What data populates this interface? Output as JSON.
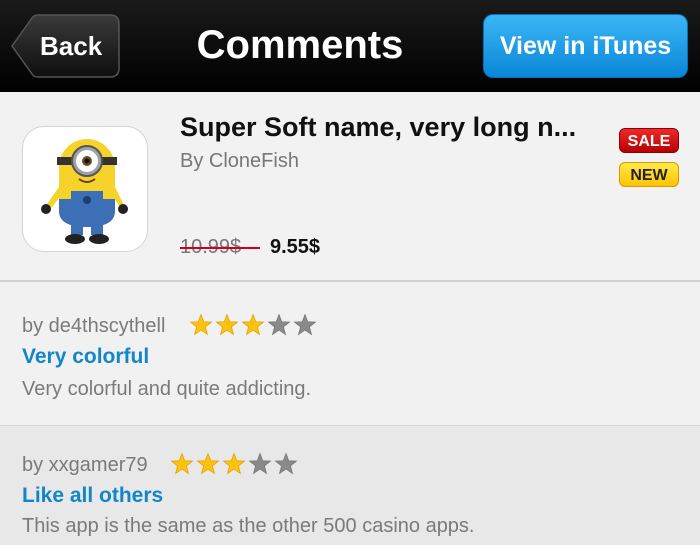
{
  "navbar": {
    "back_label": "Back",
    "title": "Comments",
    "itunes_label": "View in iTunes"
  },
  "app": {
    "icon": "minion-app-icon",
    "title": "Super Soft name, very long n...",
    "developer": "By CloneFish",
    "old_price": "10.99$",
    "new_price": "9.55$",
    "badges": {
      "sale": "SALE",
      "new": "NEW"
    }
  },
  "reviews": [
    {
      "author": "by de4thscythell",
      "rating": 3,
      "max_rating": 5,
      "title": "Very colorful",
      "body": "Very colorful and quite addicting."
    },
    {
      "author": "by xxgamer79",
      "rating": 3,
      "max_rating": 5,
      "title": "Like all others",
      "body": "This app is the same as the other 500 casino apps."
    }
  ],
  "colors": {
    "accent_blue": "#1385c9",
    "star_filled": "#ffc20e",
    "star_empty": "#8a8a8a",
    "sale_red": "#d10000",
    "new_yellow": "#ffd200"
  }
}
